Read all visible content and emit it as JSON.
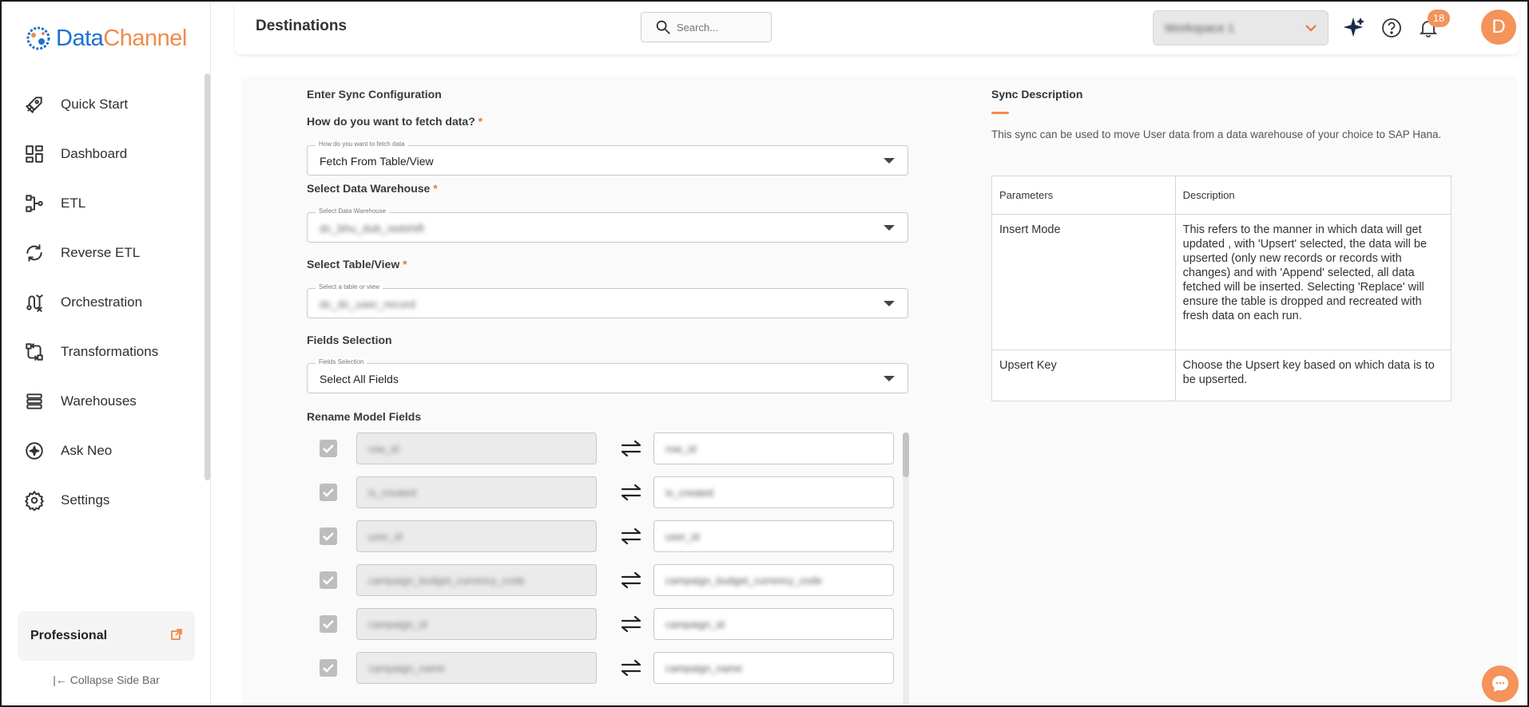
{
  "brand": {
    "name_part1": "Data",
    "name_part2": "Channel"
  },
  "sidebar": {
    "items": [
      {
        "label": "Quick Start",
        "icon": "rocket-icon"
      },
      {
        "label": "Dashboard",
        "icon": "dashboard-icon"
      },
      {
        "label": "ETL",
        "icon": "etl-icon"
      },
      {
        "label": "Reverse ETL",
        "icon": "reverse-etl-icon"
      },
      {
        "label": "Orchestration",
        "icon": "orchestration-icon"
      },
      {
        "label": "Transformations",
        "icon": "transformations-icon"
      },
      {
        "label": "Warehouses",
        "icon": "warehouses-icon"
      },
      {
        "label": "Ask Neo",
        "icon": "ask-neo-icon"
      },
      {
        "label": "Settings",
        "icon": "gear-icon"
      }
    ],
    "plan": "Professional",
    "collapse_label": "|← Collapse Side Bar"
  },
  "header": {
    "title": "Destinations",
    "search_placeholder": "Search...",
    "workspace": "Workspace 1",
    "notifications_count": "18",
    "avatar_initial": "D"
  },
  "form": {
    "section_title": "Enter Sync Configuration",
    "fetch": {
      "label": "How do you want to fetch data?",
      "float_label": "How do you want to fetch data",
      "value": "Fetch From Table/View"
    },
    "warehouse": {
      "label": "Select Data Warehouse",
      "float_label": "Select Data Warehouse",
      "value": "dc_bhu_dub_redshift"
    },
    "table": {
      "label": "Select Table/View",
      "float_label": "Select a table or view",
      "value": "dc_dc_user_record"
    },
    "fields": {
      "label": "Fields Selection",
      "float_label": "Fields Selection",
      "value": "Select All Fields"
    },
    "rename_title": "Rename Model Fields",
    "rows": [
      {
        "source": "row_id",
        "target": "row_id"
      },
      {
        "source": "is_created",
        "target": "is_created"
      },
      {
        "source": "user_id",
        "target": "user_id"
      },
      {
        "source": "campaign_budget_currency_code",
        "target": "campaign_budget_currency_code"
      },
      {
        "source": "campaign_id",
        "target": "campaign_id"
      },
      {
        "source": "campaign_name",
        "target": "campaign_name"
      }
    ]
  },
  "description": {
    "title": "Sync Description",
    "text": "This sync can be used to move User data from a data warehouse of your choice to SAP Hana.",
    "table": {
      "headers": [
        "Parameters",
        "Description"
      ],
      "rows": [
        {
          "param": "Insert Mode",
          "desc": "This refers to the manner in which data will get updated , with 'Upsert' selected, the data will be upserted (only new records or records with changes) and with 'Append' selected, all data fetched will be inserted. Selecting 'Replace' will ensure the table is dropped and recreated with fresh data on each run."
        },
        {
          "param": "Upsert Key",
          "desc": "Choose the Upsert key based on which data is to be upserted."
        }
      ]
    }
  },
  "colors": {
    "accent": "#f4935a",
    "brand_blue": "#1c6fd1"
  }
}
